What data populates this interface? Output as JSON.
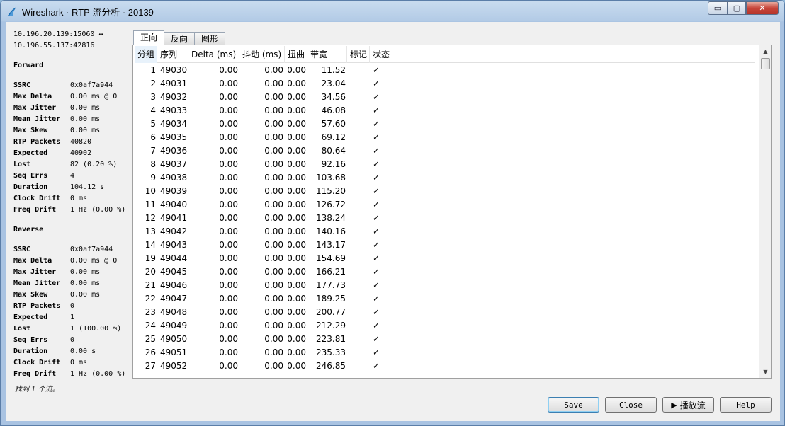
{
  "window": {
    "title": "Wireshark · RTP 流分析 · 20139",
    "minimize_glyph": "▭",
    "maximize_glyph": "▢",
    "close_glyph": "✕"
  },
  "stats": {
    "address_line1": "10.196.20.139:15060 ↔",
    "address_line2": "10.196.55.137:42816",
    "forward_title": "Forward",
    "forward": [
      {
        "k": "SSRC",
        "v": "0x0af7a944"
      },
      {
        "k": "Max Delta",
        "v": "0.00 ms @ 0"
      },
      {
        "k": "Max Jitter",
        "v": "0.00 ms"
      },
      {
        "k": "Mean Jitter",
        "v": "0.00 ms"
      },
      {
        "k": "Max Skew",
        "v": "0.00 ms"
      },
      {
        "k": "RTP Packets",
        "v": "40820"
      },
      {
        "k": "Expected",
        "v": "40902"
      },
      {
        "k": "Lost",
        "v": "82 (0.20 %)"
      },
      {
        "k": "Seq Errs",
        "v": "4"
      },
      {
        "k": "Duration",
        "v": "104.12 s"
      },
      {
        "k": "Clock Drift",
        "v": "0 ms"
      },
      {
        "k": "Freq Drift",
        "v": "1 Hz (0.00 %)"
      }
    ],
    "reverse_title": "Reverse",
    "reverse": [
      {
        "k": "SSRC",
        "v": "0x0af7a944"
      },
      {
        "k": "Max Delta",
        "v": "0.00 ms @ 0"
      },
      {
        "k": "Max Jitter",
        "v": "0.00 ms"
      },
      {
        "k": "Mean Jitter",
        "v": "0.00 ms"
      },
      {
        "k": "Max Skew",
        "v": "0.00 ms"
      },
      {
        "k": "RTP Packets",
        "v": "0"
      },
      {
        "k": "Expected",
        "v": "1"
      },
      {
        "k": "Lost",
        "v": "1 (100.00 %)"
      },
      {
        "k": "Seq Errs",
        "v": "0"
      },
      {
        "k": "Duration",
        "v": "0.00 s"
      },
      {
        "k": "Clock Drift",
        "v": "0 ms"
      },
      {
        "k": "Freq Drift",
        "v": "1 Hz (0.00 %)"
      }
    ],
    "found_text": "找到 1 个流。"
  },
  "tabs": [
    "正向",
    "反向",
    "图形"
  ],
  "table": {
    "columns": [
      "分组",
      "序列",
      "Delta (ms)",
      "抖动 (ms)",
      "扭曲",
      "带宽",
      "标记",
      "状态"
    ],
    "rows": [
      [
        "1",
        "49030",
        "0.00",
        "0.00",
        "0.00",
        "11.52",
        "",
        "✓"
      ],
      [
        "2",
        "49031",
        "0.00",
        "0.00",
        "0.00",
        "23.04",
        "",
        "✓"
      ],
      [
        "3",
        "49032",
        "0.00",
        "0.00",
        "0.00",
        "34.56",
        "",
        "✓"
      ],
      [
        "4",
        "49033",
        "0.00",
        "0.00",
        "0.00",
        "46.08",
        "",
        "✓"
      ],
      [
        "5",
        "49034",
        "0.00",
        "0.00",
        "0.00",
        "57.60",
        "",
        "✓"
      ],
      [
        "6",
        "49035",
        "0.00",
        "0.00",
        "0.00",
        "69.12",
        "",
        "✓"
      ],
      [
        "7",
        "49036",
        "0.00",
        "0.00",
        "0.00",
        "80.64",
        "",
        "✓"
      ],
      [
        "8",
        "49037",
        "0.00",
        "0.00",
        "0.00",
        "92.16",
        "",
        "✓"
      ],
      [
        "9",
        "49038",
        "0.00",
        "0.00",
        "0.00",
        "103.68",
        "",
        "✓"
      ],
      [
        "10",
        "49039",
        "0.00",
        "0.00",
        "0.00",
        "115.20",
        "",
        "✓"
      ],
      [
        "11",
        "49040",
        "0.00",
        "0.00",
        "0.00",
        "126.72",
        "",
        "✓"
      ],
      [
        "12",
        "49041",
        "0.00",
        "0.00",
        "0.00",
        "138.24",
        "",
        "✓"
      ],
      [
        "13",
        "49042",
        "0.00",
        "0.00",
        "0.00",
        "140.16",
        "",
        "✓"
      ],
      [
        "14",
        "49043",
        "0.00",
        "0.00",
        "0.00",
        "143.17",
        "",
        "✓"
      ],
      [
        "19",
        "49044",
        "0.00",
        "0.00",
        "0.00",
        "154.69",
        "",
        "✓"
      ],
      [
        "20",
        "49045",
        "0.00",
        "0.00",
        "0.00",
        "166.21",
        "",
        "✓"
      ],
      [
        "21",
        "49046",
        "0.00",
        "0.00",
        "0.00",
        "177.73",
        "",
        "✓"
      ],
      [
        "22",
        "49047",
        "0.00",
        "0.00",
        "0.00",
        "189.25",
        "",
        "✓"
      ],
      [
        "23",
        "49048",
        "0.00",
        "0.00",
        "0.00",
        "200.77",
        "",
        "✓"
      ],
      [
        "24",
        "49049",
        "0.00",
        "0.00",
        "0.00",
        "212.29",
        "",
        "✓"
      ],
      [
        "25",
        "49050",
        "0.00",
        "0.00",
        "0.00",
        "223.81",
        "",
        "✓"
      ],
      [
        "26",
        "49051",
        "0.00",
        "0.00",
        "0.00",
        "235.33",
        "",
        "✓"
      ],
      [
        "27",
        "49052",
        "0.00",
        "0.00",
        "0.00",
        "246.85",
        "",
        "✓"
      ]
    ]
  },
  "buttons": {
    "save": "Save",
    "close": "Close",
    "play": "播放流",
    "help": "Help"
  },
  "colors": {
    "title_bar": "#b3cbe6",
    "close_button": "#c7453a",
    "default_button_border": "#3c7fb1"
  }
}
